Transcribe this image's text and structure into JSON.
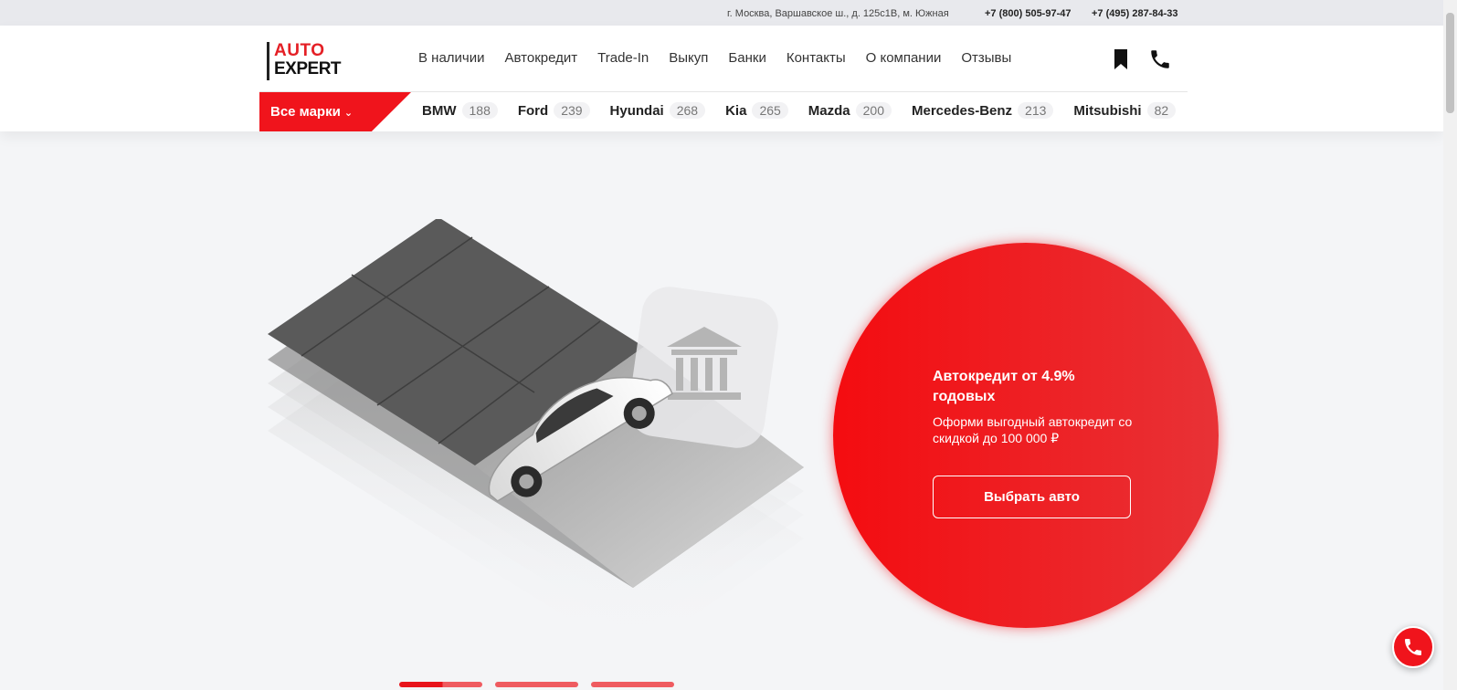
{
  "topbar": {
    "address": "г. Москва, Варшавское ш., д. 125с1В, м. Южная",
    "phone1": "+7 (800) 505-97-47",
    "phone2": "+7 (495) 287-84-33"
  },
  "logo": {
    "line1": "AUTO",
    "line2": "EXPERT"
  },
  "nav": {
    "items": [
      "В наличии",
      "Автокредит",
      "Trade-In",
      "Выкуп",
      "Банки",
      "Контакты",
      "О компании",
      "Отзывы"
    ]
  },
  "header_icons": {
    "bookmark": "bookmark-icon",
    "phone": "phone-icon"
  },
  "all_brands": {
    "label": "Все марки"
  },
  "brands": [
    {
      "name": "BMW",
      "count": "188"
    },
    {
      "name": "Ford",
      "count": "239"
    },
    {
      "name": "Hyundai",
      "count": "268"
    },
    {
      "name": "Kia",
      "count": "265"
    },
    {
      "name": "Mazda",
      "count": "200"
    },
    {
      "name": "Mercedes-Benz",
      "count": "213"
    },
    {
      "name": "Mitsubishi",
      "count": "82"
    }
  ],
  "promo": {
    "title": "Автокредит от 4.9% годовых",
    "text": "Оформи выгодный автокредит со скидкой до 100 000 ₽",
    "button": "Выбрать авто"
  },
  "slider": {
    "count": 3,
    "active": 1,
    "active_progress": 0.52
  },
  "colors": {
    "accent": "#f0141c",
    "background": "#f4f5f7",
    "topbar": "#e8e9ed"
  }
}
